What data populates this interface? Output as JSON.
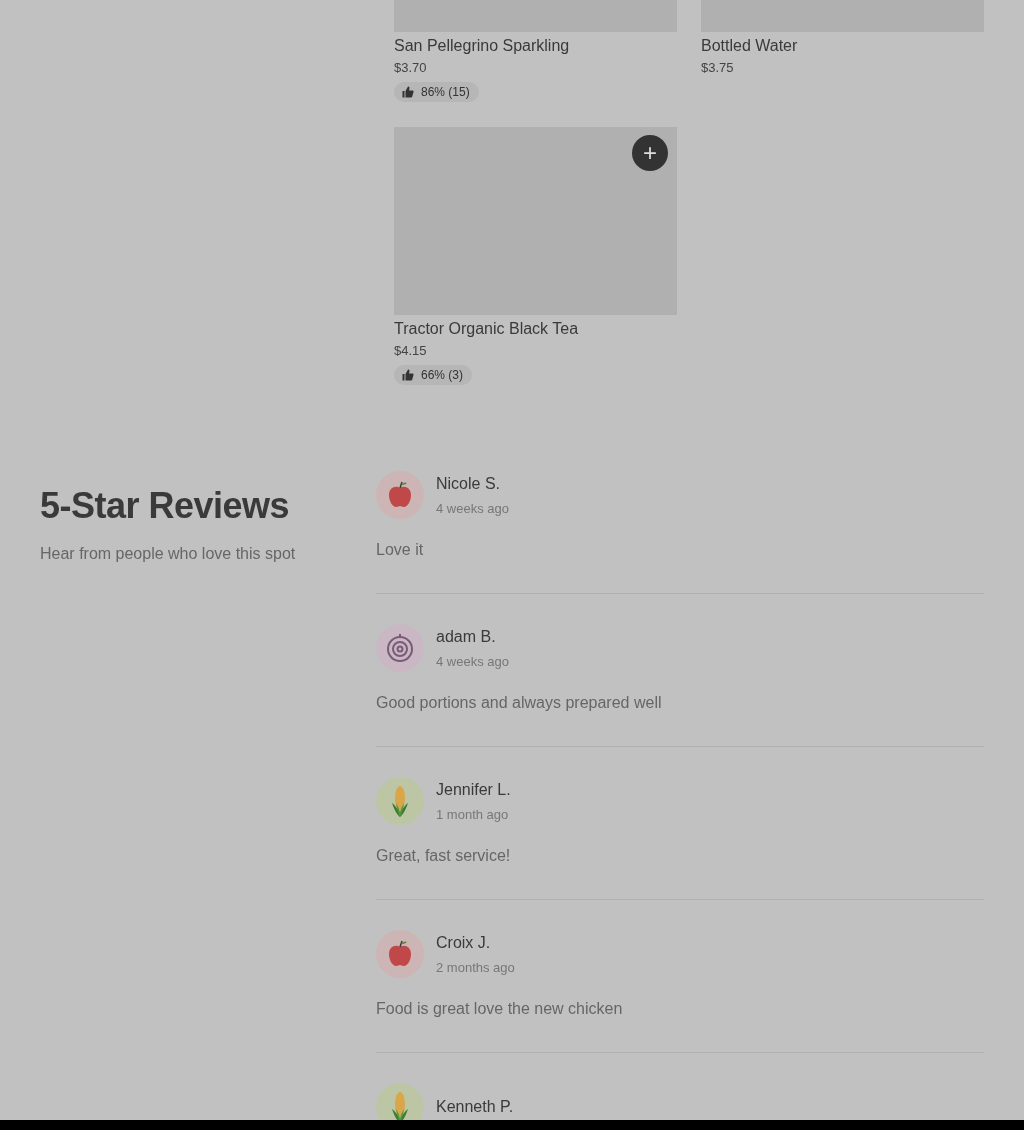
{
  "products": [
    {
      "name": "San Pellegrino Sparkling",
      "price": "$3.70",
      "rating": "86% (15)"
    },
    {
      "name": "Bottled Water",
      "price": "$3.75"
    },
    {
      "name": "Tractor Organic Black Tea",
      "price": "$4.15",
      "rating": "66% (3)",
      "add_label": "+"
    }
  ],
  "reviews_section": {
    "title": "5-Star Reviews",
    "subtitle": "Hear from people who love this spot"
  },
  "reviews": [
    {
      "name": "Nicole S.",
      "time": "4 weeks ago",
      "text": "Love it",
      "kind": "apple"
    },
    {
      "name": "adam B.",
      "time": "4 weeks ago",
      "text": "Good portions and always prepared well",
      "kind": "onion"
    },
    {
      "name": "Jennifer L.",
      "time": "1 month ago",
      "text": "Great, fast service!",
      "kind": "corn"
    },
    {
      "name": "Croix J.",
      "time": "2 months ago",
      "text": "Food is great love the new chicken",
      "kind": "apple"
    },
    {
      "name": "Kenneth P.",
      "kind": "corn"
    }
  ]
}
